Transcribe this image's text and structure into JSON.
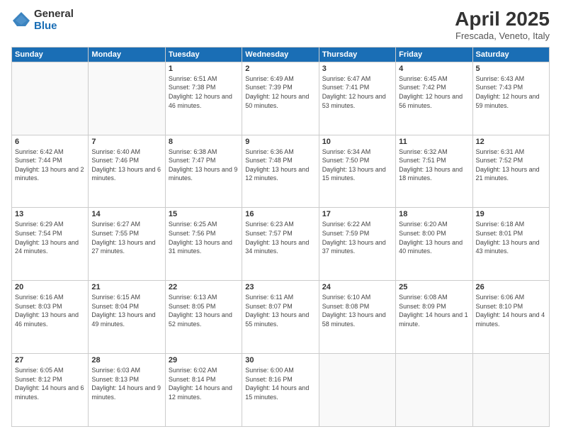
{
  "logo": {
    "general": "General",
    "blue": "Blue"
  },
  "header": {
    "month": "April 2025",
    "location": "Frescada, Veneto, Italy"
  },
  "weekdays": [
    "Sunday",
    "Monday",
    "Tuesday",
    "Wednesday",
    "Thursday",
    "Friday",
    "Saturday"
  ],
  "weeks": [
    [
      {
        "day": "",
        "detail": ""
      },
      {
        "day": "",
        "detail": ""
      },
      {
        "day": "1",
        "detail": "Sunrise: 6:51 AM\nSunset: 7:38 PM\nDaylight: 12 hours and 46 minutes."
      },
      {
        "day": "2",
        "detail": "Sunrise: 6:49 AM\nSunset: 7:39 PM\nDaylight: 12 hours and 50 minutes."
      },
      {
        "day": "3",
        "detail": "Sunrise: 6:47 AM\nSunset: 7:41 PM\nDaylight: 12 hours and 53 minutes."
      },
      {
        "day": "4",
        "detail": "Sunrise: 6:45 AM\nSunset: 7:42 PM\nDaylight: 12 hours and 56 minutes."
      },
      {
        "day": "5",
        "detail": "Sunrise: 6:43 AM\nSunset: 7:43 PM\nDaylight: 12 hours and 59 minutes."
      }
    ],
    [
      {
        "day": "6",
        "detail": "Sunrise: 6:42 AM\nSunset: 7:44 PM\nDaylight: 13 hours and 2 minutes."
      },
      {
        "day": "7",
        "detail": "Sunrise: 6:40 AM\nSunset: 7:46 PM\nDaylight: 13 hours and 6 minutes."
      },
      {
        "day": "8",
        "detail": "Sunrise: 6:38 AM\nSunset: 7:47 PM\nDaylight: 13 hours and 9 minutes."
      },
      {
        "day": "9",
        "detail": "Sunrise: 6:36 AM\nSunset: 7:48 PM\nDaylight: 13 hours and 12 minutes."
      },
      {
        "day": "10",
        "detail": "Sunrise: 6:34 AM\nSunset: 7:50 PM\nDaylight: 13 hours and 15 minutes."
      },
      {
        "day": "11",
        "detail": "Sunrise: 6:32 AM\nSunset: 7:51 PM\nDaylight: 13 hours and 18 minutes."
      },
      {
        "day": "12",
        "detail": "Sunrise: 6:31 AM\nSunset: 7:52 PM\nDaylight: 13 hours and 21 minutes."
      }
    ],
    [
      {
        "day": "13",
        "detail": "Sunrise: 6:29 AM\nSunset: 7:54 PM\nDaylight: 13 hours and 24 minutes."
      },
      {
        "day": "14",
        "detail": "Sunrise: 6:27 AM\nSunset: 7:55 PM\nDaylight: 13 hours and 27 minutes."
      },
      {
        "day": "15",
        "detail": "Sunrise: 6:25 AM\nSunset: 7:56 PM\nDaylight: 13 hours and 31 minutes."
      },
      {
        "day": "16",
        "detail": "Sunrise: 6:23 AM\nSunset: 7:57 PM\nDaylight: 13 hours and 34 minutes."
      },
      {
        "day": "17",
        "detail": "Sunrise: 6:22 AM\nSunset: 7:59 PM\nDaylight: 13 hours and 37 minutes."
      },
      {
        "day": "18",
        "detail": "Sunrise: 6:20 AM\nSunset: 8:00 PM\nDaylight: 13 hours and 40 minutes."
      },
      {
        "day": "19",
        "detail": "Sunrise: 6:18 AM\nSunset: 8:01 PM\nDaylight: 13 hours and 43 minutes."
      }
    ],
    [
      {
        "day": "20",
        "detail": "Sunrise: 6:16 AM\nSunset: 8:03 PM\nDaylight: 13 hours and 46 minutes."
      },
      {
        "day": "21",
        "detail": "Sunrise: 6:15 AM\nSunset: 8:04 PM\nDaylight: 13 hours and 49 minutes."
      },
      {
        "day": "22",
        "detail": "Sunrise: 6:13 AM\nSunset: 8:05 PM\nDaylight: 13 hours and 52 minutes."
      },
      {
        "day": "23",
        "detail": "Sunrise: 6:11 AM\nSunset: 8:07 PM\nDaylight: 13 hours and 55 minutes."
      },
      {
        "day": "24",
        "detail": "Sunrise: 6:10 AM\nSunset: 8:08 PM\nDaylight: 13 hours and 58 minutes."
      },
      {
        "day": "25",
        "detail": "Sunrise: 6:08 AM\nSunset: 8:09 PM\nDaylight: 14 hours and 1 minute."
      },
      {
        "day": "26",
        "detail": "Sunrise: 6:06 AM\nSunset: 8:10 PM\nDaylight: 14 hours and 4 minutes."
      }
    ],
    [
      {
        "day": "27",
        "detail": "Sunrise: 6:05 AM\nSunset: 8:12 PM\nDaylight: 14 hours and 6 minutes."
      },
      {
        "day": "28",
        "detail": "Sunrise: 6:03 AM\nSunset: 8:13 PM\nDaylight: 14 hours and 9 minutes."
      },
      {
        "day": "29",
        "detail": "Sunrise: 6:02 AM\nSunset: 8:14 PM\nDaylight: 14 hours and 12 minutes."
      },
      {
        "day": "30",
        "detail": "Sunrise: 6:00 AM\nSunset: 8:16 PM\nDaylight: 14 hours and 15 minutes."
      },
      {
        "day": "",
        "detail": ""
      },
      {
        "day": "",
        "detail": ""
      },
      {
        "day": "",
        "detail": ""
      }
    ]
  ]
}
